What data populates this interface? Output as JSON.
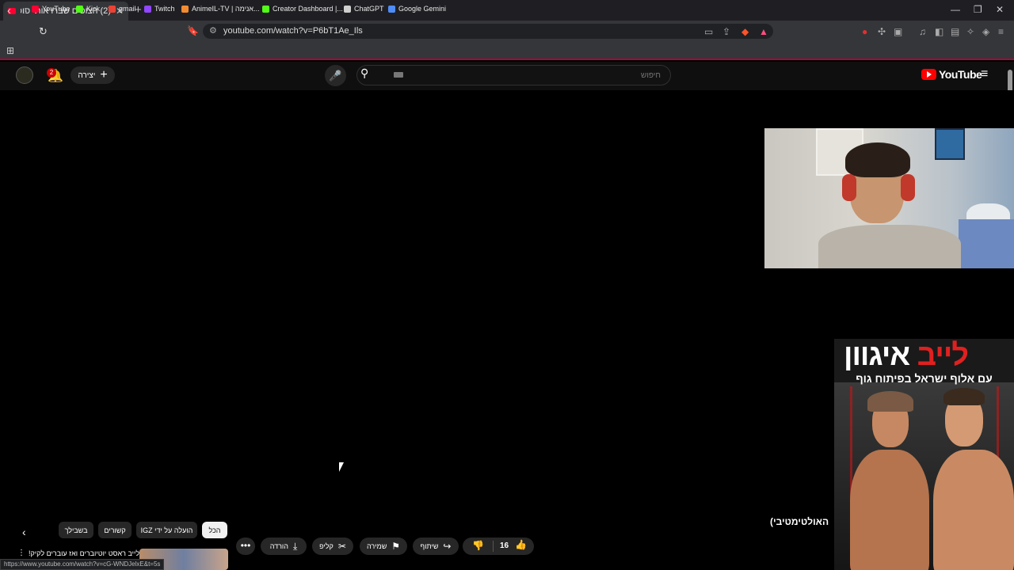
{
  "browser": {
    "tab_title": "(2) הצופים שברו אותי סופית (מכ",
    "tab_close": "✕",
    "new_tab": "+",
    "url": "youtube.com/watch?v=P6bT1Ae_Ils",
    "status_url": "https://www.youtube.com/watch?v=cG-WNDJelxE&t=5s",
    "bookmarks": [
      "YouTube",
      "Kick",
      "gmail",
      "Twitch",
      "AnimeIL-TV | אנימה...",
      "Creator Dashboard |...",
      "ChatGPT",
      "Google Gemini"
    ],
    "bookmark_colors": [
      "#ff0033",
      "#53fc18",
      "#ea4335",
      "#9146ff",
      "#f28b30",
      "#53fc18",
      "#cfcfcf",
      "#4f8cf7"
    ]
  },
  "youtube": {
    "notif_count": "2",
    "create_label": "יצירה",
    "search_placeholder": "חיפוש",
    "logo_text": "YouTube",
    "accent": "#ff0000"
  },
  "ad": {
    "title_white": "איגוון",
    "title_red": "לייב ",
    "subtitle": "עם אלוף ישראל בפיתוח גוף"
  },
  "video_title_peek": "האולטימטיבי)",
  "chips": [
    "הכל",
    "הועלה על ידי IGZ",
    "קשורים",
    "בשבילך"
  ],
  "actions": {
    "like_count": "16",
    "share": "שיתוף",
    "save": "שמירה",
    "clip": "קליפ",
    "download": "הורדה"
  },
  "reco": {
    "title": "לייב ראסט יוטיוברים ואז עוברים לקיק!"
  }
}
